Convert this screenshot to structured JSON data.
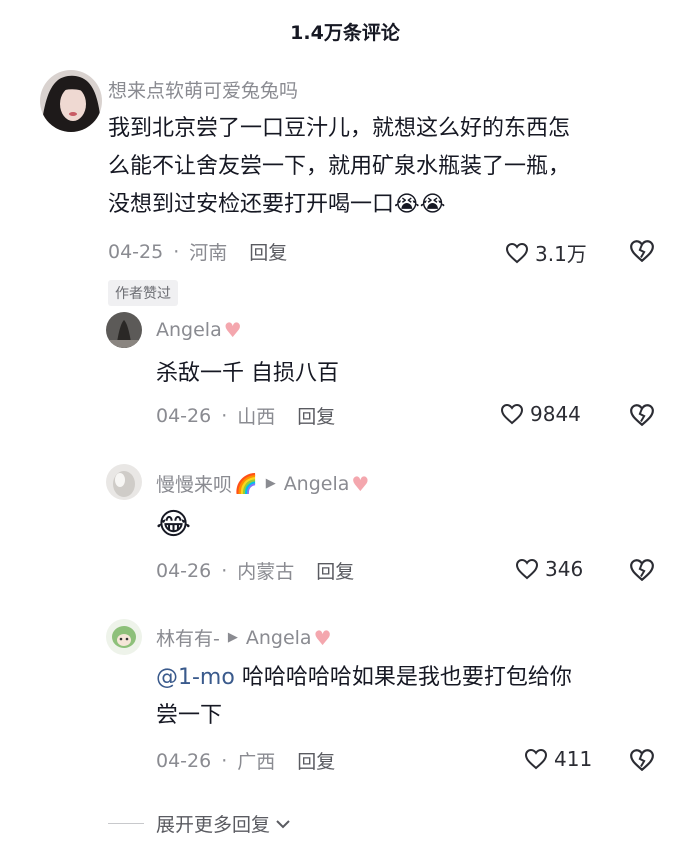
{
  "header": {
    "comment_count": "1.4万条评论"
  },
  "comments": [
    {
      "username": "想来点软萌可爱兔兔吗",
      "text_line1": "我到北京尝了一口豆汁儿，就想这么好的东西怎",
      "text_line2": "么能不让舍友尝一下，就用矿泉水瓶装了一瓶，",
      "text_line3": "没想到过安检还要打开喝一口",
      "emoji": "😭😭",
      "date": "04-25",
      "location": "河南",
      "reply_label": "回复",
      "likes": "3.1万",
      "badge": "作者赞过"
    }
  ],
  "replies": [
    {
      "username": "Angela",
      "text": "杀敌一千 自损八百",
      "date": "04-26",
      "location": "山西",
      "reply_label": "回复",
      "likes": "9844"
    },
    {
      "username": "慢慢来呗",
      "username_emoji": "🌈",
      "reply_to": "Angela",
      "emoji": "😂",
      "date": "04-26",
      "location": "内蒙古",
      "reply_label": "回复",
      "likes": "346"
    },
    {
      "username": "林有有-",
      "reply_to": "Angela",
      "mention": "@1-mo",
      "text_line1": "哈哈哈哈哈如果是我也要打包给你",
      "text_line2": "尝一下",
      "date": "04-26",
      "location": "广西",
      "reply_label": "回复",
      "likes": "411"
    }
  ],
  "footer": {
    "expand_label": "展开更多回复"
  },
  "colors": {
    "accent_heart": "#f4a7ae",
    "mention": "#3a5a8c",
    "muted": "#8a8b91"
  }
}
